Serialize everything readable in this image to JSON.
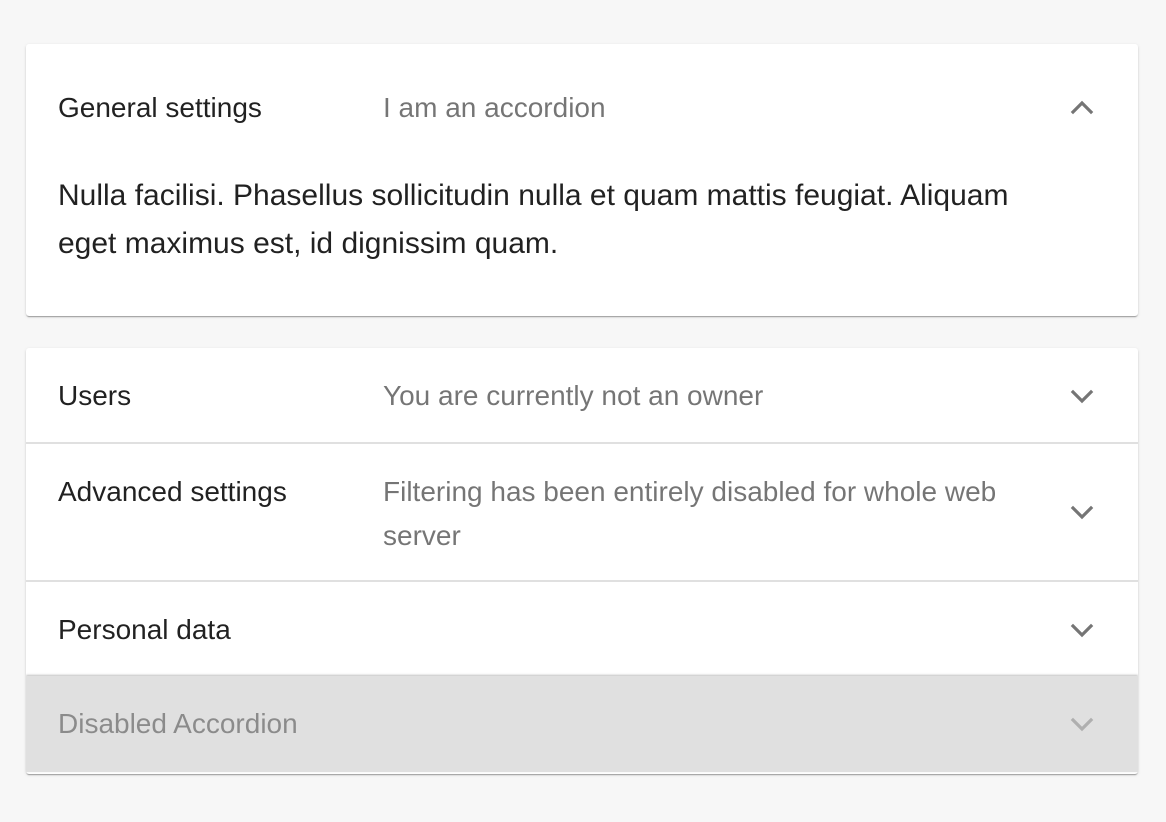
{
  "accordion": {
    "general": {
      "title": "General settings",
      "subtitle": "I am an accordion",
      "expanded": true,
      "body": "Nulla facilisi. Phasellus sollicitudin nulla et quam mattis feugiat. Aliquam eget maximus est, id dignissim quam.",
      "icon": "chevron-up-icon"
    },
    "users": {
      "title": "Users",
      "subtitle": "You are currently not an owner",
      "expanded": false,
      "icon": "chevron-down-icon"
    },
    "advanced": {
      "title": "Advanced settings",
      "subtitle": "Filtering has been entirely disabled for whole web server",
      "expanded": false,
      "icon": "chevron-down-icon"
    },
    "personal": {
      "title": "Personal data",
      "subtitle": "",
      "expanded": false,
      "icon": "chevron-down-icon"
    },
    "disabled": {
      "title": "Disabled Accordion",
      "disabled": true,
      "icon": "chevron-down-icon"
    }
  },
  "colors": {
    "background": "#f7f7f7",
    "panel": "#ffffff",
    "disabled_panel": "#e0e0e0",
    "divider": "#e0e0e0"
  }
}
